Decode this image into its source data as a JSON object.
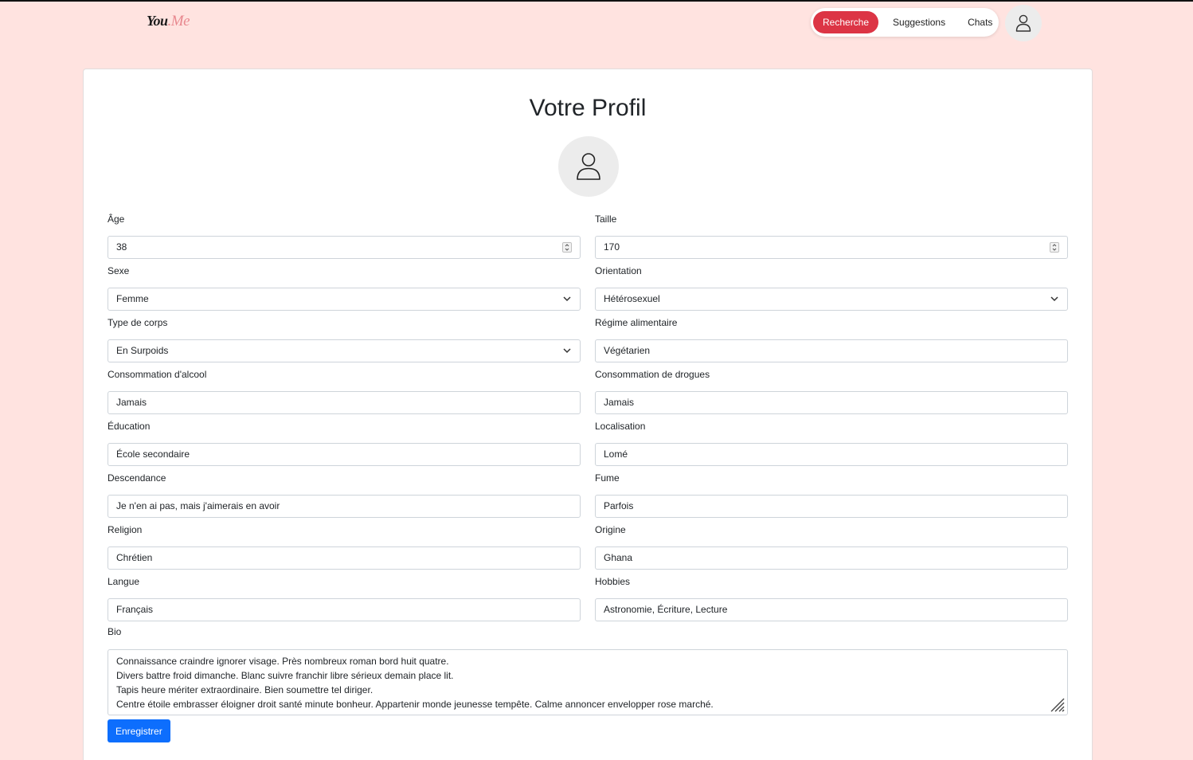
{
  "header": {
    "logo_main": "You",
    "logo_accent": ".Me",
    "nav": [
      {
        "label": "Recherche",
        "active": true
      },
      {
        "label": "Suggestions",
        "active": false
      },
      {
        "label": "Chats",
        "active": false
      }
    ],
    "user_icon": "user-icon"
  },
  "profile": {
    "title": "Votre Profil",
    "avatar_icon": "user-icon",
    "fields": {
      "age": {
        "label": "Âge",
        "value": "38",
        "kind": "number"
      },
      "taille": {
        "label": "Taille",
        "value": "170",
        "kind": "number"
      },
      "sexe": {
        "label": "Sexe",
        "value": "Femme",
        "kind": "select"
      },
      "orientation": {
        "label": "Orientation",
        "value": "Hétérosexuel",
        "kind": "select"
      },
      "type_corps": {
        "label": "Type de corps",
        "value": "En Surpoids",
        "kind": "select"
      },
      "regime": {
        "label": "Régime alimentaire",
        "value": "Végétarien",
        "kind": "text"
      },
      "alcool": {
        "label": "Consommation d'alcool",
        "value": "Jamais",
        "kind": "text"
      },
      "drogues": {
        "label": "Consommation de drogues",
        "value": "Jamais",
        "kind": "text"
      },
      "education": {
        "label": "Éducation",
        "value": "École secondaire",
        "kind": "text"
      },
      "localisation": {
        "label": "Localisation",
        "value": "Lomé",
        "kind": "text"
      },
      "descendance": {
        "label": "Descendance",
        "value": "Je n'en ai pas, mais j'aimerais en avoir",
        "kind": "text"
      },
      "fume": {
        "label": "Fume",
        "value": "Parfois",
        "kind": "text"
      },
      "religion": {
        "label": "Religion",
        "value": "Chrétien",
        "kind": "text"
      },
      "origine": {
        "label": "Origine",
        "value": "Ghana",
        "kind": "text"
      },
      "langue": {
        "label": "Langue",
        "value": "Français",
        "kind": "text"
      },
      "hobbies": {
        "label": "Hobbies",
        "value": "Astronomie, Écriture, Lecture",
        "kind": "text"
      }
    },
    "bio": {
      "label": "Bio",
      "lines": [
        "Connaissance craindre ignorer visage. Près nombreux roman bord huit quatre.",
        "Divers battre froid dimanche. Blanc suivre franchir libre sérieux demain place lit.",
        "Tapis heure mériter extraordinaire. Bien soumettre tel diriger.",
        "Centre étoile embrasser éloigner droit santé minute bonheur. Appartenir monde jeunesse tempête. Calme annoncer envelopper rose marché."
      ]
    },
    "save_label": "Enregistrer"
  },
  "colors": {
    "page_bg": "#ffe3e0",
    "accent_red": "#dc3545",
    "primary_blue": "#0d6efd",
    "logo_accent": "#e8888f"
  }
}
